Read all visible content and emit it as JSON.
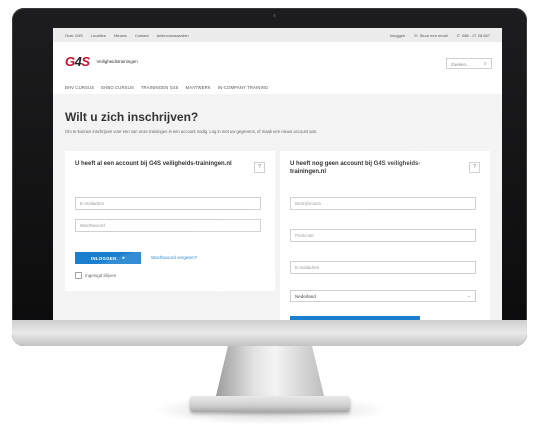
{
  "topbar": {
    "links": [
      "Over G4S",
      "Locaties",
      "Nieuws",
      "Contact",
      "Actievoorwaarden"
    ],
    "login": "Inloggen",
    "email": "Stuur een email",
    "phone": "088 - 27 28 657"
  },
  "header": {
    "logo_text": "G4S",
    "logo_name": "Veiligheidstrainingen",
    "search_placeholder": "Zoeken..."
  },
  "nav": {
    "items": [
      "BHV CURSUS",
      "EHBO CURSUS",
      "TRAININGEN G4S",
      "MAATWERK",
      "IN-COMPANY TRAINING"
    ]
  },
  "page": {
    "title": "Wilt u zich inschrijven?",
    "intro": "Om te kunnen inschrijven voor een van onze trainingen is een account nodig. Log in met uw gegevens, of maak een nieuw account aan."
  },
  "login_panel": {
    "title": "U heeft al een account bij G4S veiligheids-trainingen.nl",
    "help": "?",
    "email_placeholder": "E-mailadres",
    "password_placeholder": "Wachtwoord",
    "login_button": "INLOGGEN",
    "login_arrow": "▸",
    "forgot": "Wachtwoord vergeten?",
    "remember": "Ingelogd blijven"
  },
  "register_panel": {
    "title": "U heeft nog geen account bij G4S veiligheids-trainingen.nl",
    "help": "?",
    "company_placeholder": "Bedrijfsnaam",
    "postcode_placeholder": "Postcode",
    "email_placeholder": "E-mailadres",
    "country": "Nederland"
  },
  "icons": {
    "mail": "mail-icon",
    "phone": "phone-icon",
    "search": "search-icon",
    "chevron": "chevron-down-icon"
  },
  "colors": {
    "accent": "#1a7fce",
    "brand_red": "#c8102e"
  }
}
